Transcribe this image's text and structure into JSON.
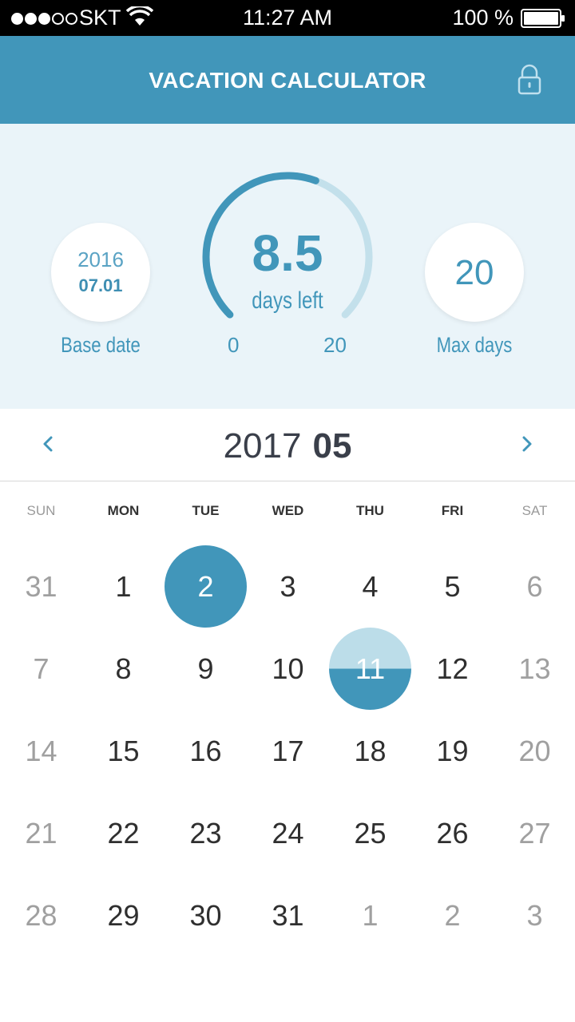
{
  "status_bar": {
    "carrier": "SKT",
    "time": "11:27 AM",
    "battery": "100 %",
    "signal_dots_filled": 3,
    "signal_dots_total": 5
  },
  "header": {
    "title": "VACATION CALCULATOR",
    "lock_icon": "lock-icon"
  },
  "summary": {
    "base_date": {
      "year": "2016",
      "month_day": "07.01",
      "label": "Base date"
    },
    "gauge": {
      "value": "8.5",
      "sub_label": "days left",
      "min": "0",
      "max": "20",
      "remaining": 8.5,
      "total": 20
    },
    "max_days": {
      "value": "20",
      "label": "Max days"
    }
  },
  "calendar": {
    "year": "2017",
    "month": "05",
    "prev_icon": "chevron-left-icon",
    "next_icon": "chevron-right-icon",
    "weekdays": [
      "SUN",
      "MON",
      "TUE",
      "WED",
      "THU",
      "FRI",
      "SAT"
    ],
    "weeks": [
      [
        "31",
        "1",
        "2",
        "3",
        "4",
        "5",
        "6"
      ],
      [
        "7",
        "8",
        "9",
        "10",
        "11",
        "12",
        "13"
      ],
      [
        "14",
        "15",
        "16",
        "17",
        "18",
        "19",
        "20"
      ],
      [
        "21",
        "22",
        "23",
        "24",
        "25",
        "26",
        "27"
      ],
      [
        "28",
        "29",
        "30",
        "31",
        "1",
        "2",
        "3"
      ]
    ],
    "selected_day": "2",
    "highlighted_day": "11"
  },
  "colors": {
    "accent": "#4196ba",
    "summary_bg": "#eaf4f9",
    "gauge_track": "#c3e0eb",
    "weekend_text": "#a0a0a0"
  }
}
